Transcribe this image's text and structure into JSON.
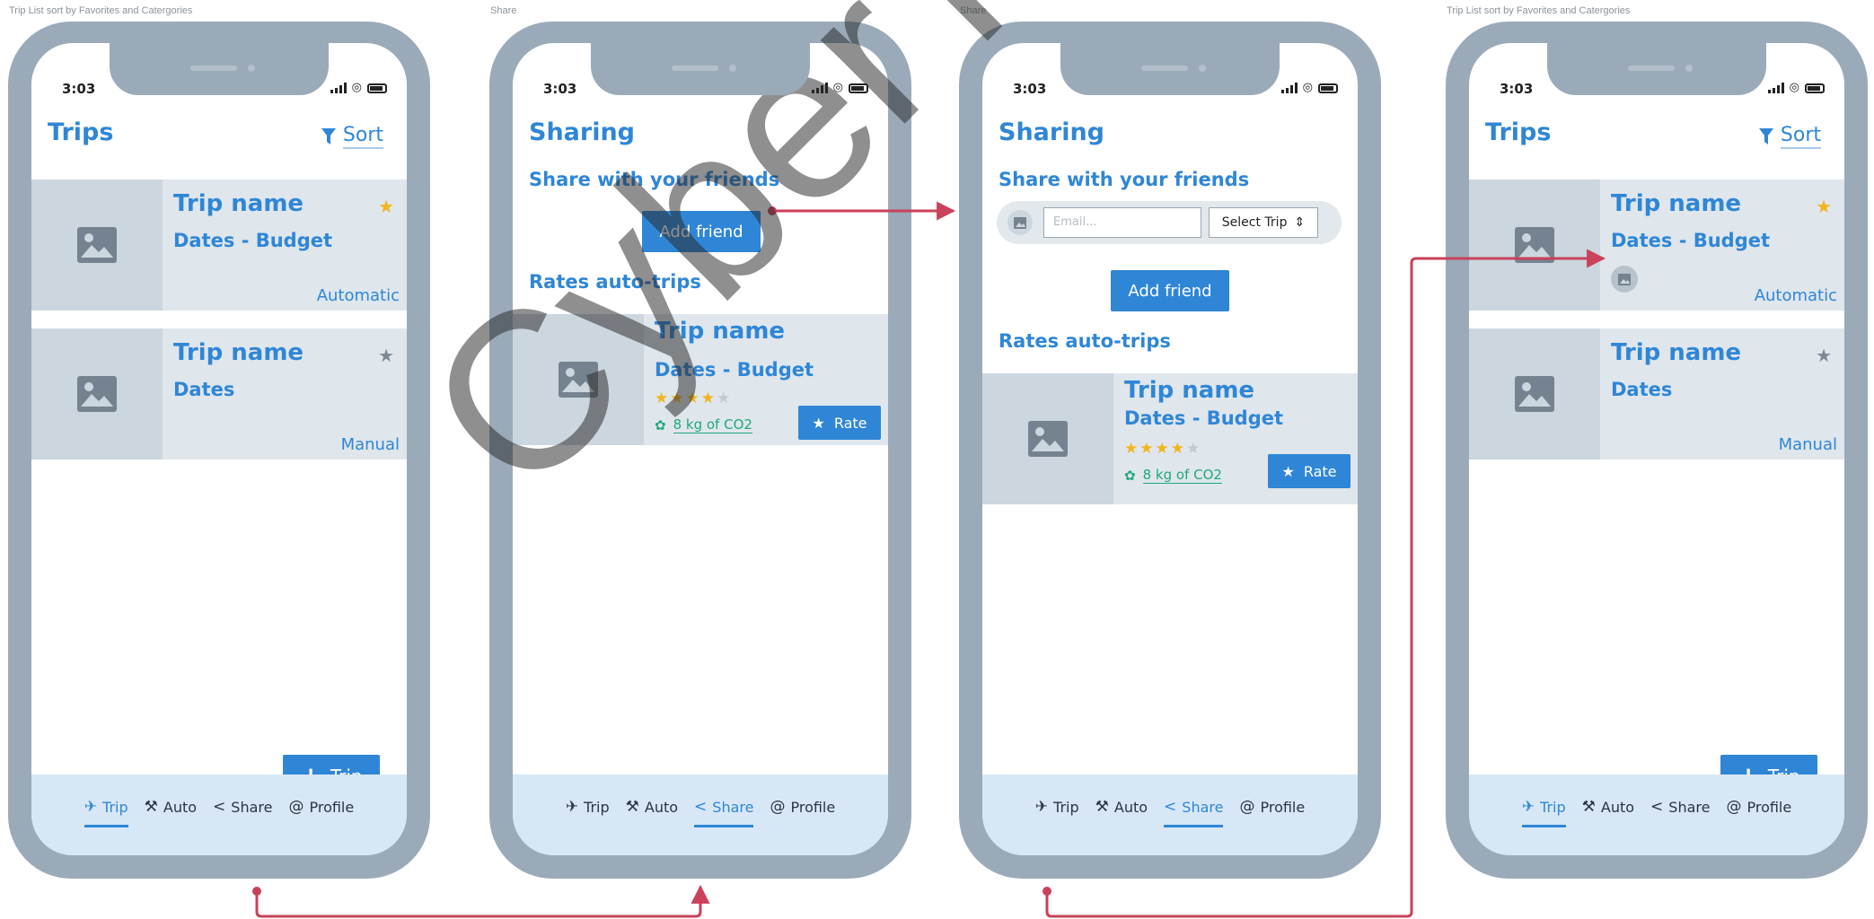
{
  "captions": [
    "Trip List sort by Favorites and Catergories",
    "Share",
    "Share",
    "Trip List sort by Favorites and Catergories"
  ],
  "status": {
    "time": "3:03"
  },
  "trips_screen": {
    "title": "Trips",
    "sort_label": "Sort",
    "trips": [
      {
        "name": "Trip name",
        "dates": "Dates - Budget",
        "type": "Automatic",
        "favorite": true
      },
      {
        "name": "Trip name",
        "dates": "Dates",
        "type": "Manual",
        "favorite": false
      }
    ],
    "add_trip_label": "Trip"
  },
  "share_screen": {
    "title": "Sharing",
    "subtitle": "Share with your friends",
    "add_friend_label": "Add friend",
    "rates_title": "Rates auto-trips",
    "email_placeholder": "Email...",
    "select_trip_label": "Select Trip",
    "rated_trip": {
      "name": "Trip name",
      "dates": "Dates - Budget",
      "rating": 4,
      "rating_max": 5,
      "co2": "8 kg of CO2",
      "rate_label": "Rate"
    }
  },
  "nav": {
    "trip": "Trip",
    "auto": "Auto",
    "share": "Share",
    "profile": "Profile"
  },
  "watermark": "CyberTorn",
  "colors": {
    "accent": "#2f86d6",
    "star_fav": "#f2b51b",
    "star_off": "#7d8893",
    "flow_arrow": "#c9415a",
    "eco": "#20a87a"
  }
}
